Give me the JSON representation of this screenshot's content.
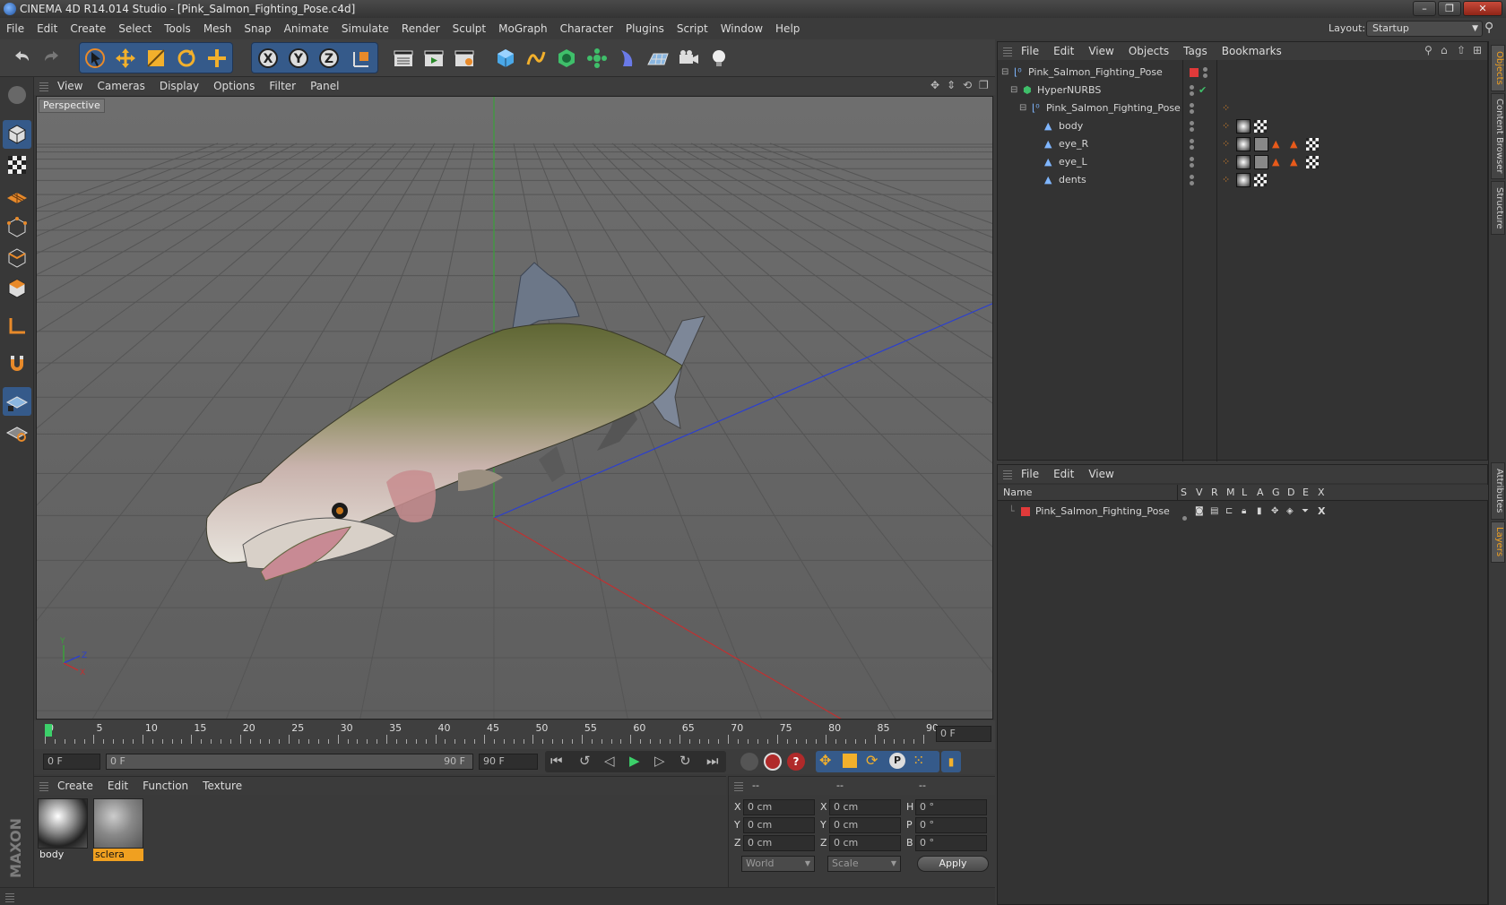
{
  "window": {
    "title": "CINEMA 4D R14.014 Studio - [Pink_Salmon_Fighting_Pose.c4d]",
    "controls": [
      "–",
      "❐",
      "✕"
    ]
  },
  "menubar": {
    "items": [
      "File",
      "Edit",
      "Create",
      "Select",
      "Tools",
      "Mesh",
      "Snap",
      "Animate",
      "Simulate",
      "Render",
      "Sculpt",
      "MoGraph",
      "Character",
      "Plugins",
      "Script",
      "Window",
      "Help"
    ]
  },
  "layout": {
    "label": "Layout:",
    "value": "Startup"
  },
  "viewport": {
    "menu": [
      "View",
      "Cameras",
      "Display",
      "Options",
      "Filter",
      "Panel"
    ],
    "label": "Perspective",
    "axis": {
      "x": "X",
      "y": "Y",
      "z": "Z"
    }
  },
  "timeline": {
    "ticks": [
      "0",
      "5",
      "10",
      "15",
      "20",
      "25",
      "30",
      "35",
      "40",
      "45",
      "50",
      "55",
      "60",
      "65",
      "70",
      "75",
      "80",
      "85",
      "90"
    ],
    "current": "0 F"
  },
  "transport": {
    "start": "0 F",
    "range_left": "0 F",
    "range_right": "90 F",
    "end": "90 F"
  },
  "materials": {
    "menu": [
      "Create",
      "Edit",
      "Function",
      "Texture"
    ],
    "items": [
      {
        "name": "body"
      },
      {
        "name": "sclera"
      }
    ]
  },
  "coords": {
    "headers": [
      "--",
      "--",
      "--"
    ],
    "rows": [
      {
        "a": "X",
        "av": "0 cm",
        "b": "X",
        "bv": "0 cm",
        "c": "H",
        "cv": "0 °"
      },
      {
        "a": "Y",
        "av": "0 cm",
        "b": "Y",
        "bv": "0 cm",
        "c": "P",
        "cv": "0 °"
      },
      {
        "a": "Z",
        "av": "0 cm",
        "b": "Z",
        "bv": "0 cm",
        "c": "B",
        "cv": "0 °"
      }
    ],
    "space": "World",
    "mode": "Scale",
    "apply": "Apply"
  },
  "object_manager": {
    "menu": [
      "File",
      "Edit",
      "View",
      "Objects",
      "Tags",
      "Bookmarks"
    ],
    "objects": [
      {
        "name": "Pink_Salmon_Fighting_Pose",
        "indent": 0
      },
      {
        "name": "HyperNURBS",
        "indent": 1
      },
      {
        "name": "Pink_Salmon_Fighting_Pose",
        "indent": 2
      },
      {
        "name": "body",
        "indent": 3
      },
      {
        "name": "eye_R",
        "indent": 3
      },
      {
        "name": "eye_L",
        "indent": 3
      },
      {
        "name": "dents",
        "indent": 3
      }
    ]
  },
  "layer_manager": {
    "menu": [
      "File",
      "Edit",
      "View"
    ],
    "columns": {
      "name": "Name",
      "flags": [
        "S",
        "V",
        "R",
        "M",
        "L",
        "A",
        "G",
        "D",
        "E",
        "X"
      ]
    },
    "layers": [
      {
        "name": "Pink_Salmon_Fighting_Pose",
        "color": "#e03a3a"
      }
    ]
  },
  "side_tabs": [
    "Objects",
    "Content Browser",
    "Structure",
    "Attributes",
    "Layers"
  ],
  "brand": "MAXON CINEMA 4D",
  "colors": {
    "accent": "#355a8a",
    "layer_red": "#e03a3a",
    "material_selected": "#f0a020"
  }
}
